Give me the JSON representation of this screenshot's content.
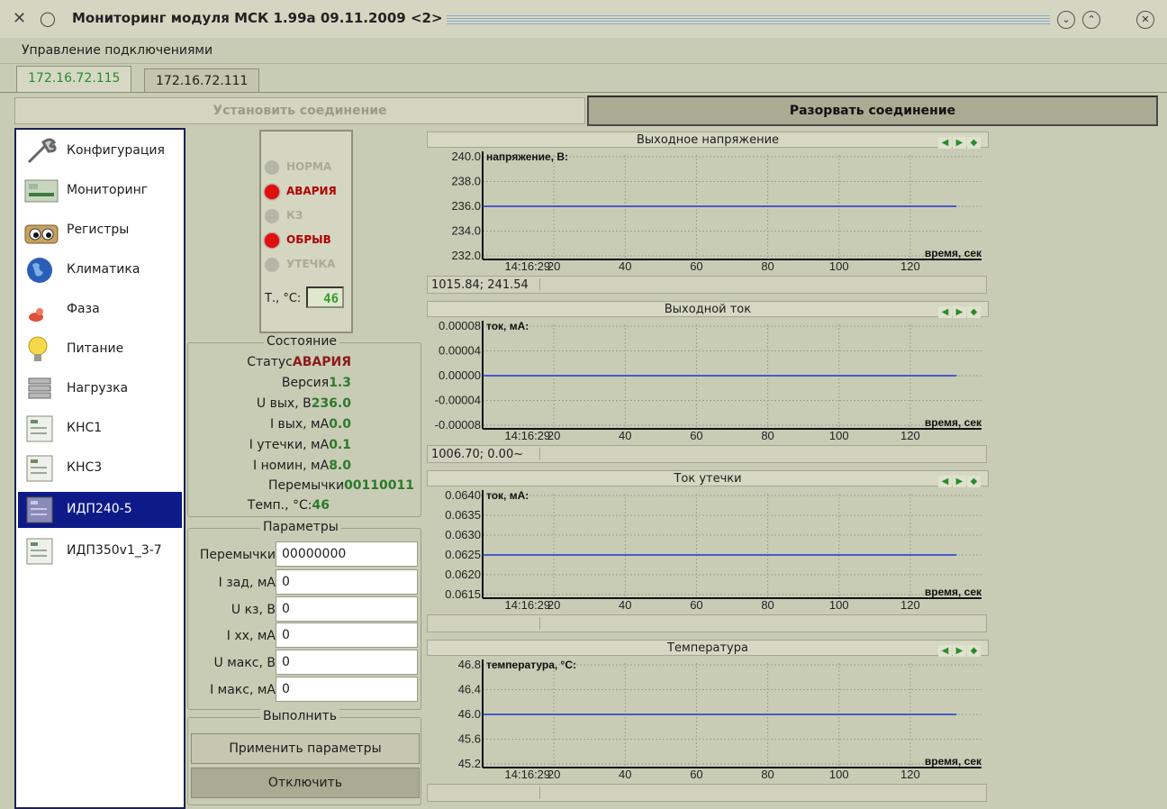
{
  "window": {
    "title": "Мониторинг модуля МСК 1.99а 09.11.2009 <2>"
  },
  "menu": {
    "connection_management": "Управление подключениями"
  },
  "tabs": [
    {
      "label": "172.16.72.115",
      "active": true
    },
    {
      "label": "172.16.72.111",
      "active": false
    }
  ],
  "connection": {
    "connect_label": "Установить соединение",
    "disconnect_label": "Разорвать соединение"
  },
  "sidebar": {
    "items": [
      {
        "label": "Конфигурация",
        "icon": "wrench-icon"
      },
      {
        "label": "Мониторинг",
        "icon": "monitoring-icon"
      },
      {
        "label": "Регистры",
        "icon": "eyes-icon"
      },
      {
        "label": "Климатика",
        "icon": "globe-icon"
      },
      {
        "label": "Фаза",
        "icon": "phase-icon"
      },
      {
        "label": "Питание",
        "icon": "lightbulb-icon"
      },
      {
        "label": "Нагрузка",
        "icon": "server-icon"
      },
      {
        "label": "КНС1",
        "icon": "device-thumb-icon"
      },
      {
        "label": "КНС3",
        "icon": "device-thumb-icon"
      },
      {
        "label": "ИДП240-5",
        "icon": "device-thumb-icon",
        "selected": true
      },
      {
        "label": "ИДП350v1_3-7",
        "icon": "device-thumb-icon"
      }
    ]
  },
  "indicators": {
    "leds": [
      {
        "label": "НОРМА",
        "state": "off"
      },
      {
        "label": "АВАРИЯ",
        "state": "on"
      },
      {
        "label": "КЗ",
        "state": "off"
      },
      {
        "label": "ОБРЫВ",
        "state": "on"
      },
      {
        "label": "УТЕЧКА",
        "state": "off"
      }
    ],
    "temp_label": "Т., °С:",
    "temp_value": "46"
  },
  "state": {
    "title": "Состояние",
    "rows": [
      {
        "key": "Статус",
        "value": "АВАРИЯ",
        "alarm": true
      },
      {
        "key": "Версия",
        "value": "1.3"
      },
      {
        "key": "U вых, В",
        "value": "236.0"
      },
      {
        "key": "I вых, мА",
        "value": "0.0"
      },
      {
        "key": "I утечки, мА",
        "value": "0.1"
      },
      {
        "key": "I номин, мА",
        "value": "8.0"
      },
      {
        "key": "Перемычки",
        "value": "00110011"
      },
      {
        "key": "Темп., °С:",
        "value": "46"
      }
    ]
  },
  "params": {
    "title": "Параметры",
    "rows": [
      {
        "label": "Перемычки",
        "value": "00000000"
      },
      {
        "label": "I зад, мА",
        "value": "0"
      },
      {
        "label": "U кз, В",
        "value": "0"
      },
      {
        "label": "I хх, мА",
        "value": "0"
      },
      {
        "label": "U макс, В",
        "value": "0"
      },
      {
        "label": "I макс, мА",
        "value": "0"
      }
    ]
  },
  "actions": {
    "title": "Выполнить",
    "apply_label": "Применить параметры",
    "disable_label": "Отключить"
  },
  "chart_data": [
    {
      "type": "line",
      "title": "Выходное напряжение",
      "ylabel": "напряжение, В:",
      "xlabel": "время, сек",
      "y_ticks": [
        "240.0",
        "238.0",
        "236.0",
        "234.0",
        "232.0"
      ],
      "ylim": [
        232,
        240
      ],
      "x_tick_labels": [
        "14:16:29",
        "20",
        "40",
        "60",
        "80",
        "100",
        "120"
      ],
      "x_ticks": [
        0,
        20,
        40,
        60,
        80,
        100,
        120
      ],
      "xlim": [
        0,
        140
      ],
      "series": [
        {
          "x": [
            0,
            133
          ],
          "y": [
            236.0,
            236.0
          ],
          "color": "#2233cc"
        }
      ],
      "status": "1015.84; 241.54"
    },
    {
      "type": "line",
      "title": "Выходной ток",
      "ylabel": "ток, мА:",
      "xlabel": "время, сек",
      "y_ticks": [
        "0.00008",
        "0.00004",
        "0.00000",
        "-0.00004",
        "-0.00008"
      ],
      "ylim": [
        -8e-05,
        8e-05
      ],
      "x_tick_labels": [
        "14:16:29",
        "20",
        "40",
        "60",
        "80",
        "100",
        "120"
      ],
      "x_ticks": [
        0,
        20,
        40,
        60,
        80,
        100,
        120
      ],
      "xlim": [
        0,
        140
      ],
      "series": [
        {
          "x": [
            0,
            133
          ],
          "y": [
            0.0,
            0.0
          ],
          "color": "#2233cc"
        }
      ],
      "status": "1006.70; 0.00~"
    },
    {
      "type": "line",
      "title": "Ток утечки",
      "ylabel": "ток, мА:",
      "xlabel": "время, сек",
      "y_ticks": [
        "0.0640",
        "0.0635",
        "0.0630",
        "0.0625",
        "0.0620",
        "0.0615"
      ],
      "ylim": [
        0.0615,
        0.064
      ],
      "x_tick_labels": [
        "14:16:29",
        "20",
        "40",
        "60",
        "80",
        "100",
        "120"
      ],
      "x_ticks": [
        0,
        20,
        40,
        60,
        80,
        100,
        120
      ],
      "xlim": [
        0,
        140
      ],
      "series": [
        {
          "x": [
            0,
            133
          ],
          "y": [
            0.0625,
            0.0625
          ],
          "color": "#2233cc"
        }
      ],
      "status": ""
    },
    {
      "type": "line",
      "title": "Температура",
      "ylabel": "температура, °С:",
      "xlabel": "время, сек",
      "y_ticks": [
        "46.8",
        "46.4",
        "46.0",
        "45.6",
        "45.2"
      ],
      "ylim": [
        45.2,
        46.8
      ],
      "x_tick_labels": [
        "14:16:29",
        "20",
        "40",
        "60",
        "80",
        "100",
        "120"
      ],
      "x_ticks": [
        0,
        20,
        40,
        60,
        80,
        100,
        120
      ],
      "xlim": [
        0,
        140
      ],
      "series": [
        {
          "x": [
            0,
            133
          ],
          "y": [
            46.0,
            46.0
          ],
          "color": "#2233cc"
        }
      ],
      "status": ""
    }
  ]
}
